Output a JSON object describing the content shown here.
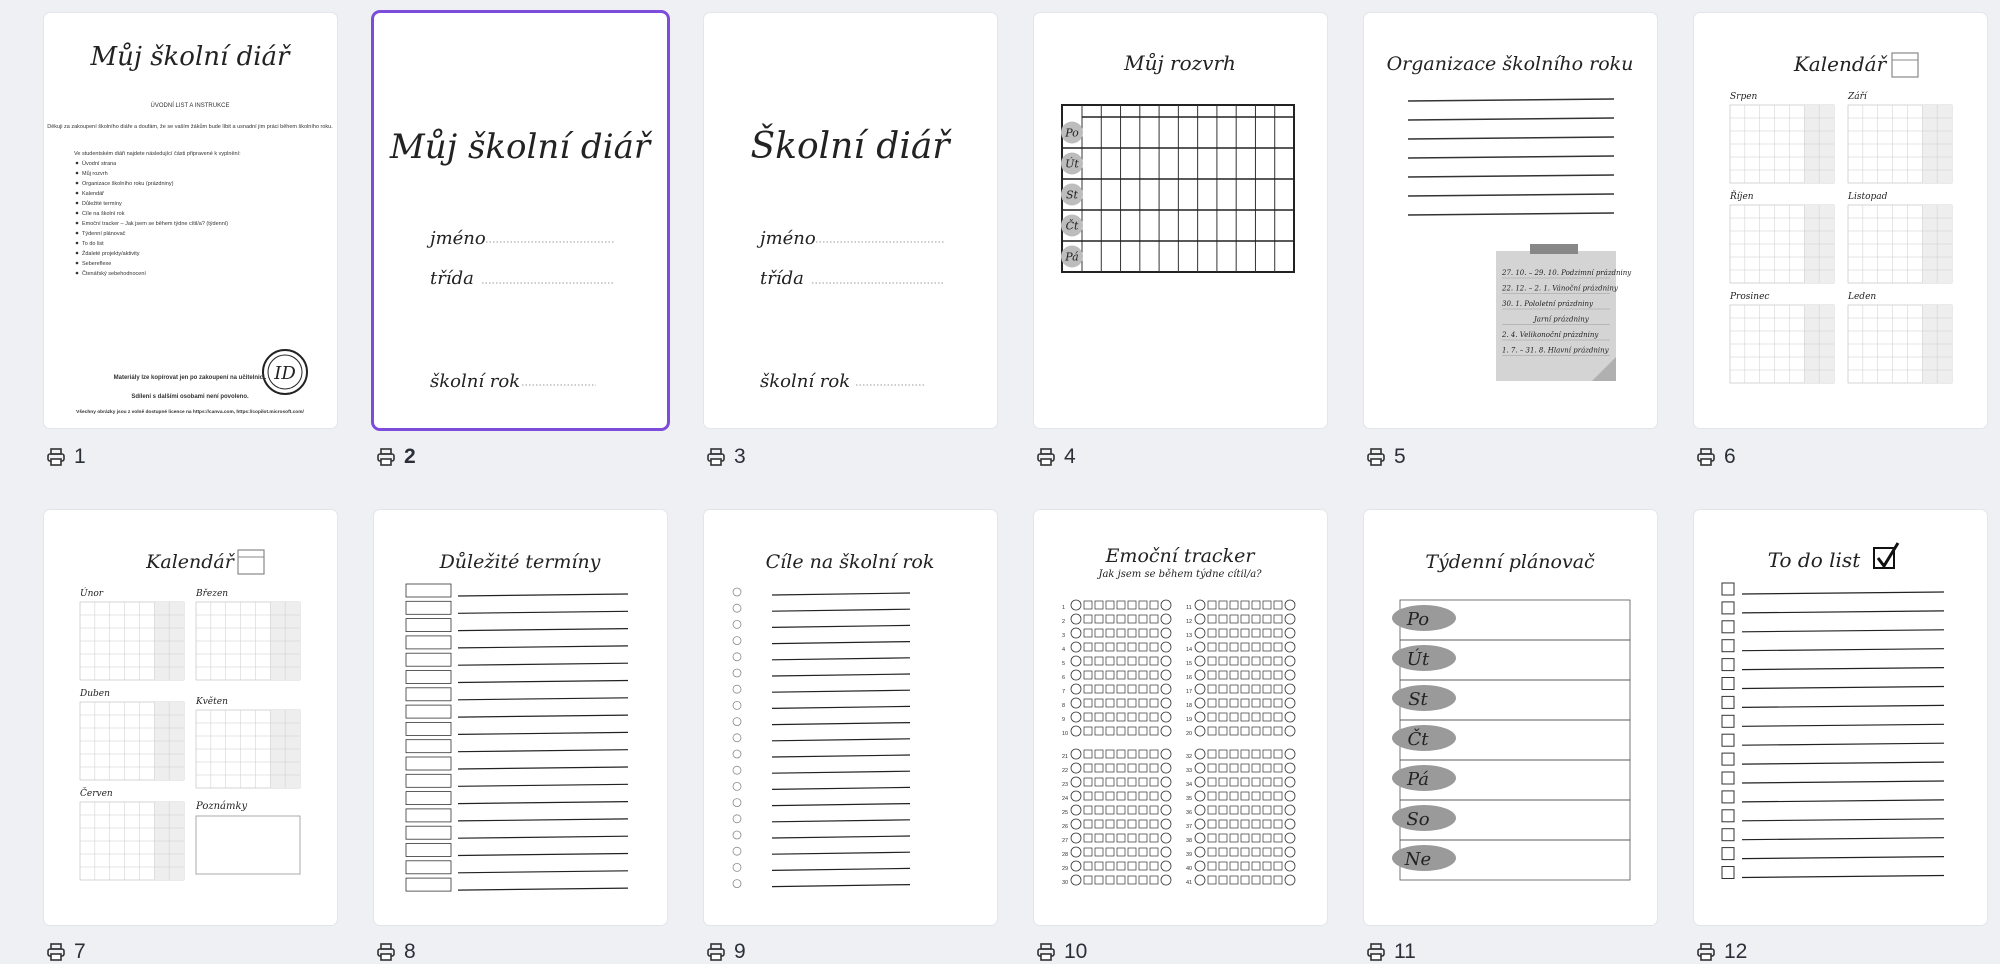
{
  "selected_page": "2",
  "pages": [
    {
      "number": "1",
      "title": "Můj školní diář",
      "subtitle": "ÚVODNÍ LIST A INSTRUKCE",
      "intro": "Děkuji za zakoupení školního diáře a doufám, že se vaším žákům bude líbit a usnadní jim práci během školního roku.",
      "list_heading": "Ve studentském diáři najdete následující části připravené k vyplnění:",
      "items": [
        "Úvodní strana",
        "Můj rozvrh",
        "Organizace školního roku (prázdniny)",
        "Kalendář",
        "Důležité termíny",
        "Cíle na školní rok",
        "Emoční tracker – Jak jsem se během týdne cítil/a? (týdenní)",
        "Týdenní plánovač",
        "To do list",
        "Ždaleté projekty/aktivity",
        "Sebereflexe",
        "Čtenářský sebehodnocení"
      ],
      "copy_note": "Materiály lze kopírovat jen po zakoupení na učitelnici.",
      "share_note": "Sdílení s dalšími osobami není povoleno.",
      "license_note": "Všechny obrázky jsou z volně dostupné licence na https://canva.com, https://copilot.microsoft.com/",
      "logo": "ID"
    },
    {
      "number": "2",
      "title": "Můj školní diář",
      "field_name": "jméno",
      "field_class": "třída",
      "field_year": "školní rok"
    },
    {
      "number": "3",
      "title": "Školní diář",
      "field_name": "jméno",
      "field_class": "třída",
      "field_year": "školní rok"
    },
    {
      "number": "4",
      "title": "Můj rozvrh",
      "days": [
        "Po",
        "Út",
        "St",
        "Čt",
        "Pá"
      ]
    },
    {
      "number": "5",
      "title": "Organizace školního roku",
      "note_lines": [
        "27. 10. – 29. 10. Podzimní prázdniny",
        "22. 12. – 2. 1. Vánoční prázdniny",
        "30. 1. Pololetní prázdniny",
        "Jarní prázdniny",
        "2. 4. Velikonoční prázdniny",
        "1. 7. – 31. 8. Hlavní prázdniny"
      ]
    },
    {
      "number": "6",
      "title": "Kalendář",
      "months": [
        "Srpen",
        "Září",
        "Říjen",
        "Listopad",
        "Prosinec",
        "Leden"
      ]
    },
    {
      "number": "7",
      "title": "Kalendář",
      "months": [
        "Únor",
        "Březen",
        "Duben",
        "Květen",
        "Červen"
      ],
      "notes_label": "Poznámky"
    },
    {
      "number": "8",
      "title": "Důležité termíny"
    },
    {
      "number": "9",
      "title": "Cíle na školní rok"
    },
    {
      "number": "10",
      "title": "Emoční tracker",
      "subtitle": "Jak jsem se během týdne cítil/a?"
    },
    {
      "number": "11",
      "title": "Týdenní plánovač",
      "days": [
        "Po",
        "Út",
        "St",
        "Čt",
        "Pá",
        "So",
        "Ne"
      ]
    },
    {
      "number": "12",
      "title": "To do list"
    }
  ],
  "icons": {
    "page_label_icon": "printer-icon",
    "checkbox_icon": "checkmark-box-icon",
    "calendar_icon": "calendar-icon"
  },
  "colors": {
    "background": "#eef0f4",
    "selection": "#7d4cdb",
    "page": "#ffffff",
    "ink": "#222222"
  }
}
